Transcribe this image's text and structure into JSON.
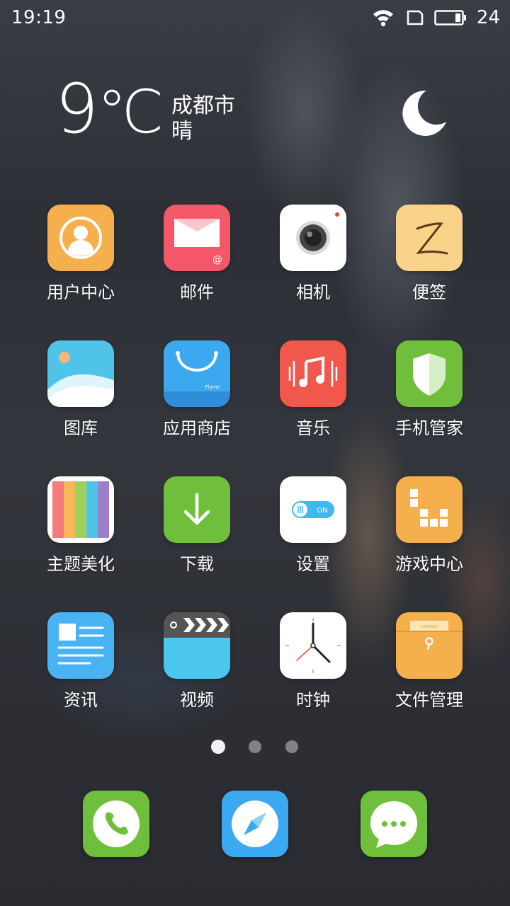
{
  "status_bar": {
    "time": "19:19",
    "battery_level": "24",
    "icons": [
      "wifi-icon",
      "sim-card-icon",
      "battery-icon"
    ]
  },
  "weather": {
    "temperature": "9",
    "unit": "℃",
    "city": "成都市",
    "condition": "晴",
    "icon": "moon-icon"
  },
  "apps": [
    {
      "label": "用户中心",
      "icon": "user-center-icon"
    },
    {
      "label": "邮件",
      "icon": "mail-icon"
    },
    {
      "label": "相机",
      "icon": "camera-icon"
    },
    {
      "label": "便签",
      "icon": "notes-icon"
    },
    {
      "label": "图库",
      "icon": "gallery-icon"
    },
    {
      "label": "应用商店",
      "icon": "app-store-icon",
      "badge_text": "Flyme"
    },
    {
      "label": "音乐",
      "icon": "music-icon"
    },
    {
      "label": "手机管家",
      "icon": "phone-manager-icon"
    },
    {
      "label": "主题美化",
      "icon": "themes-icon"
    },
    {
      "label": "下载",
      "icon": "download-icon"
    },
    {
      "label": "设置",
      "icon": "settings-icon",
      "toggle_text": "ON"
    },
    {
      "label": "游戏中心",
      "icon": "game-center-icon"
    },
    {
      "label": "资讯",
      "icon": "news-icon"
    },
    {
      "label": "视频",
      "icon": "video-icon"
    },
    {
      "label": "时钟",
      "icon": "clock-icon"
    },
    {
      "label": "文件管理",
      "icon": "file-manager-icon",
      "tag_text": "CONTACT"
    }
  ],
  "page_indicator": {
    "pages": 3,
    "current": 1
  },
  "dock": [
    {
      "icon": "phone-icon"
    },
    {
      "icon": "browser-icon"
    },
    {
      "icon": "messages-icon"
    }
  ],
  "colors": {
    "orange": "#f5b04d",
    "pink": "#f4566a",
    "green": "#6fbf3c",
    "blue": "#4ab3f4",
    "red": "#f2574c"
  }
}
